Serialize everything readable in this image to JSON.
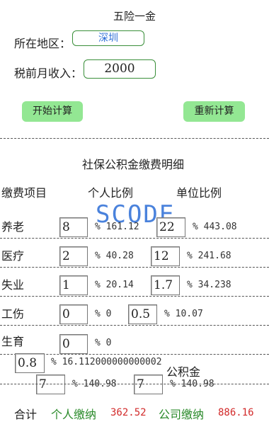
{
  "header": {
    "title": "五险一金"
  },
  "form": {
    "region_label": "所在地区：",
    "region_value": "深圳",
    "income_label": "税前月收入：",
    "income_value": "2000"
  },
  "buttons": {
    "calculate": "开始计算",
    "reset": "重新计算"
  },
  "details": {
    "title": "社保公积金缴费明细",
    "col_item": "缴费项目",
    "col_personal": "个人比例",
    "col_unit": "单位比例",
    "rows": [
      {
        "name": "养老",
        "p_rate": "8",
        "p_amt": "% 161.12",
        "u_rate": "22",
        "u_amt": "% 443.08"
      },
      {
        "name": "医疗",
        "p_rate": "2",
        "p_amt": "% 40.28",
        "u_rate": "12",
        "u_amt": "% 241.68"
      },
      {
        "name": "失业",
        "p_rate": "1",
        "p_amt": "% 20.14",
        "u_rate": "1.7",
        "u_amt": "% 34.238"
      },
      {
        "name": "工伤",
        "p_rate": "0",
        "p_amt": "% 0",
        "u_rate": "0.5",
        "u_amt": "% 10.07"
      },
      {
        "name": "生育",
        "p_rate": "0",
        "p_amt": "% 0"
      }
    ],
    "extra_rate": "0.8",
    "extra_amt": "% 16.112000000000002",
    "fund_label": "公积金",
    "fund_p_rate": "7",
    "fund_p_amt": "% 140.98",
    "fund_u_rate": "7",
    "fund_u_amt": "% 140.98"
  },
  "totals": {
    "label": "合计",
    "personal_label": "个人缴纳",
    "personal_value": "362.52",
    "company_label": "公司缴纳",
    "company_value": "886.16"
  },
  "watermark": "SCODE",
  "colors": {
    "button_bg": "#93e793",
    "field_border": "#3a8f3a",
    "label_green": "#2a8a2a",
    "value_red": "#d22a2a"
  }
}
